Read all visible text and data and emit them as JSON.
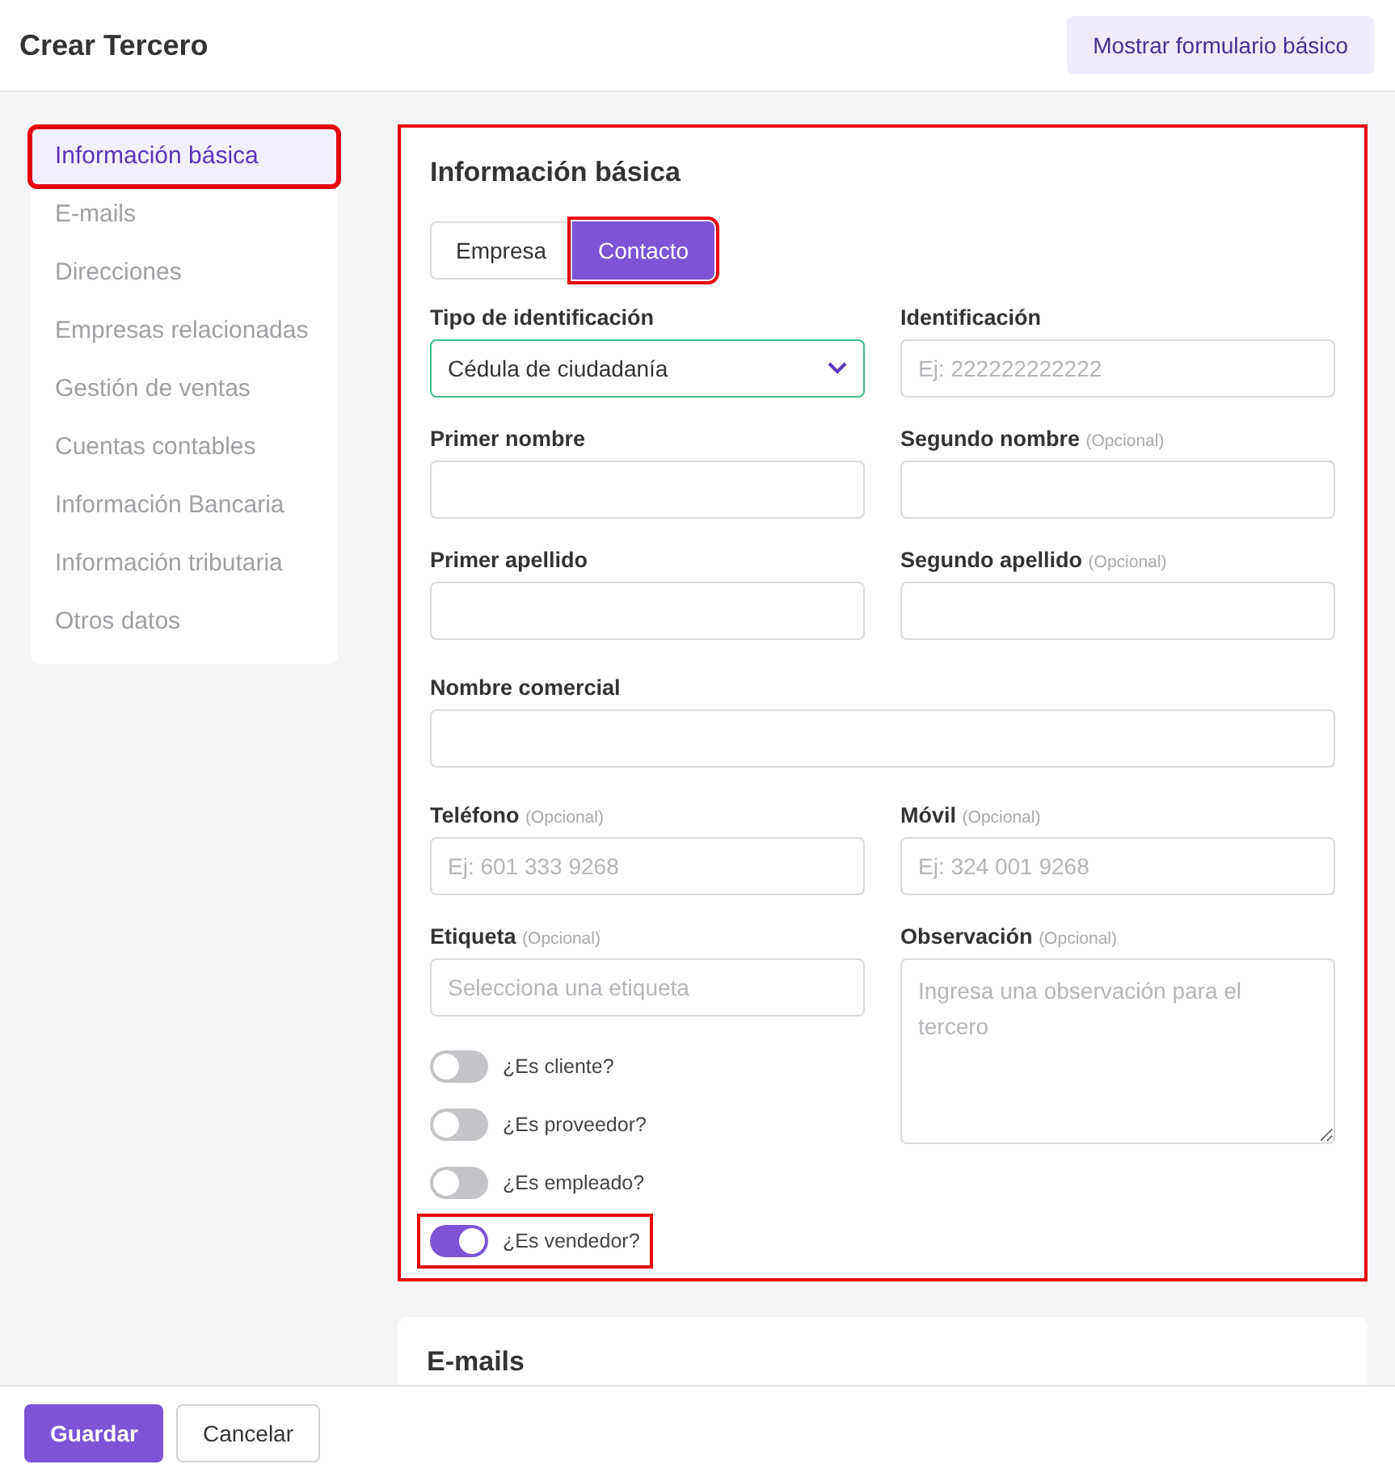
{
  "header": {
    "title": "Crear Tercero",
    "action": "Mostrar formulario básico"
  },
  "sidebar": {
    "items": [
      {
        "label": "Información básica",
        "selected": true,
        "highlighted": true
      },
      {
        "label": "E-mails",
        "selected": false,
        "highlighted": false
      },
      {
        "label": "Direcciones",
        "selected": false,
        "highlighted": false
      },
      {
        "label": "Empresas relacionadas",
        "selected": false,
        "highlighted": false
      },
      {
        "label": "Gestión de ventas",
        "selected": false,
        "highlighted": false
      },
      {
        "label": "Cuentas contables",
        "selected": false,
        "highlighted": false
      },
      {
        "label": "Información Bancaria",
        "selected": false,
        "highlighted": false
      },
      {
        "label": "Información tributaria",
        "selected": false,
        "highlighted": false
      },
      {
        "label": "Otros datos",
        "selected": false,
        "highlighted": false
      }
    ]
  },
  "sections": [
    {
      "title": "Información básica",
      "highlighted": true,
      "tabs": [
        {
          "label": "Empresa",
          "selected": false,
          "highlighted": false
        },
        {
          "label": "Contacto",
          "selected": true,
          "highlighted": true
        }
      ],
      "rows": [
        {
          "left": [
            {
              "kind": "select",
              "label": "Tipo de identificación",
              "value": "Cédula de ciudadanía"
            }
          ],
          "right": [
            {
              "kind": "text",
              "label": "Identificación",
              "placeholder": "Ej: 222222222222"
            }
          ]
        },
        {
          "left": [
            {
              "kind": "text",
              "label": "Primer nombre"
            }
          ],
          "right": [
            {
              "kind": "text",
              "label": "Segundo nombre",
              "hint": "(Opcional)"
            }
          ]
        },
        {
          "left": [
            {
              "kind": "text",
              "label": "Primer apellido"
            }
          ],
          "right": [
            {
              "kind": "text",
              "label": "Segundo apellido",
              "hint": "(Opcional)"
            }
          ]
        },
        {
          "full": [
            {
              "kind": "text",
              "label": "Nombre comercial"
            }
          ]
        },
        {
          "left": [
            {
              "kind": "text",
              "label": "Teléfono",
              "hint": "(Opcional)",
              "placeholder": "Ej: 601 333 9268"
            }
          ],
          "right": [
            {
              "kind": "text",
              "label": "Móvil",
              "hint": "(Opcional)",
              "placeholder": "Ej: 324 001 9268"
            }
          ]
        },
        {
          "left": [
            {
              "kind": "text",
              "label": "Etiqueta",
              "hint": "(Opcional)",
              "placeholder": "Selecciona una etiqueta"
            },
            {
              "kind": "toggle",
              "label": "¿Es cliente?",
              "on": false
            },
            {
              "kind": "toggle",
              "label": "¿Es proveedor?",
              "on": false
            },
            {
              "kind": "toggle",
              "label": "¿Es empleado?",
              "on": false
            },
            {
              "kind": "toggle",
              "label": "¿Es vendedor?",
              "on": true,
              "highlighted": true
            }
          ],
          "right": [
            {
              "kind": "textarea",
              "label": "Observación",
              "hint": "(Opcional)",
              "placeholder": "Ingresa una observación para el tercero"
            }
          ]
        }
      ]
    },
    {
      "title": "E-mails"
    }
  ],
  "footer": {
    "buttons": [
      {
        "label": "Guardar",
        "kind": "primary"
      },
      {
        "label": "Cancelar",
        "kind": "secondary"
      }
    ]
  }
}
